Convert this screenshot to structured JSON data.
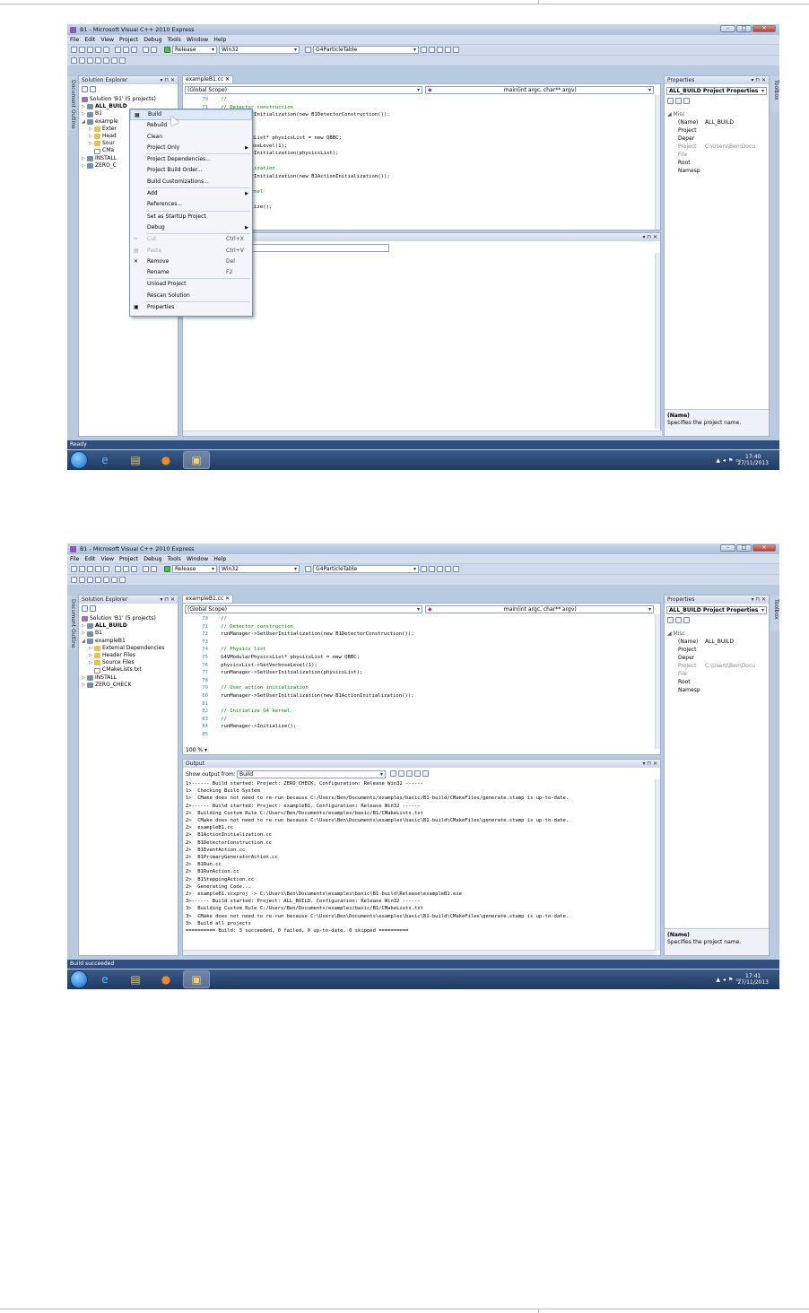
{
  "window": {
    "title": "B1 - Microsoft Visual C++ 2010 Express"
  },
  "menu": [
    "File",
    "Edit",
    "View",
    "Project",
    "Debug",
    "Tools",
    "Window",
    "Help"
  ],
  "toolbar": {
    "configuration": "Release",
    "platform": "Win32",
    "find_combo": "G4ParticleTable"
  },
  "solution_explorer": {
    "title": "Solution Explorer",
    "vertical_tab": "Document Outline",
    "items": [
      "Solution 'B1' (5 projects)",
      "ALL_BUILD",
      "B1",
      "exampleB1",
      "External Dependencies",
      "Header Files",
      "Source Files",
      "CMakeLists.txt",
      "INSTALL",
      "ZERO_CHECK"
    ],
    "truncated": {
      "exampleB1": "example",
      "external": "Exter",
      "header": "Head",
      "source": "Sour",
      "cmake": "CMa",
      "install": "INSTALL",
      "zero": "ZERO_C"
    }
  },
  "editor": {
    "tab": "exampleB1.cc",
    "scope": "(Global Scope)",
    "function": "main(int argc, char** argv)",
    "zoom": "100 %",
    "lines": [
      {
        "n": "70",
        "t": "   //",
        "c": "cm"
      },
      {
        "n": "71",
        "t": "   // Detector construction",
        "c": "cm"
      },
      {
        "n": "72",
        "t": "   runManager->SetUserInitialization(new B1DetectorConstruction());",
        "c": ""
      },
      {
        "n": "73",
        "t": "",
        "c": ""
      },
      {
        "n": "74",
        "t": "   // Physics list",
        "c": "cm"
      },
      {
        "n": "75",
        "t": "   G4VModularPhysicsList* physicsList = new QBBC;",
        "c": ""
      },
      {
        "n": "76",
        "t": "   physicsList->SetVerboseLevel(1);",
        "c": ""
      },
      {
        "n": "77",
        "t": "   runManager->SetUserInitialization(physicsList);",
        "c": ""
      },
      {
        "n": "78",
        "t": "",
        "c": ""
      },
      {
        "n": "79",
        "t": "   // User action initialization",
        "c": "cm"
      },
      {
        "n": "80",
        "t": "   runManager->SetUserInitialization(new B1ActionInitialization());",
        "c": ""
      },
      {
        "n": "81",
        "t": "",
        "c": ""
      },
      {
        "n": "82",
        "t": "   // Initialize G4 kernel",
        "c": "cm"
      },
      {
        "n": "83",
        "t": "   //",
        "c": "cm"
      },
      {
        "n": "84",
        "t": "   runManager->Initialize();",
        "c": ""
      },
      {
        "n": "85",
        "t": "",
        "c": ""
      }
    ],
    "partial_lines_1": [
      {
        "t": "   //",
        "c": "cm"
      },
      {
        "t": "   // Detector construction",
        "c": "cm"
      },
      {
        "t": "nager->SetUserInitialization(new B1DetectorConstruction());",
        "c": ""
      },
      {
        "t": "",
        "c": ""
      },
      {
        "t": "ics list",
        "c": "cm"
      },
      {
        "t": "ModularPhysicsList* physicsList = new QBBC;",
        "c": ""
      },
      {
        "t": "list->SetVerboseLevel(1);",
        "c": ""
      },
      {
        "t": "nager->SetUserInitialization(physicsList);",
        "c": ""
      },
      {
        "t": "",
        "c": ""
      },
      {
        "t": "action initialization",
        "c": "cm"
      },
      {
        "t": "nager->SetUserInitialization(new B1ActionInitialization());",
        "c": ""
      },
      {
        "t": "",
        "c": ""
      },
      {
        "t": "tialize G4 kernel",
        "c": "cm"
      },
      {
        "t": "",
        "c": ""
      },
      {
        "t": "nager->Initialize();",
        "c": ""
      }
    ]
  },
  "output": {
    "title": "Output",
    "show_from_label": "Show output from:",
    "show_from_value": "Build",
    "lines": [
      "1>------ Build started: Project: ZERO_CHECK, Configuration: Release Win32 ------",
      "1>  Checking Build System",
      "1>  CMake does not need to re-run because C:/Users/Ben/Documents/examples/basic/B1-build/CMakeFiles/generate.stamp is up-to-date.",
      "2>------ Build started: Project: exampleB1, Configuration: Release Win32 ------",
      "2>  Building Custom Rule C:/Users/Ben/Documents/examples/basic/B1/CMakeLists.txt",
      "2>  CMake does not need to re-run because C:\\Users\\Ben\\Documents\\examples\\basic\\B1-build\\CMakeFiles\\generate.stamp is up-to-date.",
      "2>  exampleB1.cc",
      "2>  B1ActionInitialization.cc",
      "2>  B1DetectorConstruction.cc",
      "2>  B1EventAction.cc",
      "2>  B1PrimaryGeneratorAction.cc",
      "2>  B1Run.cc",
      "2>  B1RunAction.cc",
      "2>  B1SteppingAction.cc",
      "2>  Generating Code...",
      "2>  exampleB1.vcxproj -> C:\\Users\\Ben\\Documents\\examples\\basic\\B1-build\\Release\\exampleB1.exe",
      "3>------ Build started: Project: ALL_BUILD, Configuration: Release Win32 ------",
      "3>  Building Custom Rule C:/Users/Ben/Documents/examples/basic/B1/CMakeLists.txt",
      "3>  CMake does not need to re-run because C:\\Users\\Ben\\Documents\\examples\\basic\\B1-build\\CMakeFiles\\generate.stamp is up-to-date.",
      "3>  Build all projects",
      "========== Build: 3 succeeded, 0 failed, 0 up-to-date, 0 skipped =========="
    ]
  },
  "properties": {
    "title": "Properties",
    "vertical_tab": "Toolbox",
    "object": "ALL_BUILD  Project Properties",
    "category": "Misc",
    "rows": [
      {
        "k": "(Name)",
        "v": "ALL_BUILD",
        "dim": false
      },
      {
        "k": "Project Deper",
        "v": "",
        "dim": false
      },
      {
        "k": "Project File",
        "v": "C:\\Users\\Ben\\Docu",
        "dim": true
      },
      {
        "k": "Root Namesp",
        "v": "",
        "dim": false
      }
    ],
    "desc_title": "(Name)",
    "desc_text": "Specifies the project name."
  },
  "context_menu": {
    "items": [
      {
        "label": "Build",
        "shortcut": "",
        "arrow": false,
        "hl": true,
        "dis": false,
        "icon": "build-icon",
        "sep_after": false
      },
      {
        "label": "Rebuild",
        "shortcut": "",
        "arrow": false,
        "hl": false,
        "dis": false,
        "icon": "",
        "sep_after": false
      },
      {
        "label": "Clean",
        "shortcut": "",
        "arrow": false,
        "hl": false,
        "dis": false,
        "icon": "",
        "sep_after": false
      },
      {
        "label": "Project Only",
        "shortcut": "",
        "arrow": true,
        "hl": false,
        "dis": false,
        "icon": "",
        "sep_after": true
      },
      {
        "label": "Project Dependencies...",
        "shortcut": "",
        "arrow": false,
        "hl": false,
        "dis": false,
        "icon": "",
        "sep_after": false
      },
      {
        "label": "Project Build Order...",
        "shortcut": "",
        "arrow": false,
        "hl": false,
        "dis": false,
        "icon": "",
        "sep_after": false
      },
      {
        "label": "Build Customizations...",
        "shortcut": "",
        "arrow": false,
        "hl": false,
        "dis": false,
        "icon": "",
        "sep_after": true
      },
      {
        "label": "Add",
        "shortcut": "",
        "arrow": true,
        "hl": false,
        "dis": false,
        "icon": "",
        "sep_after": false
      },
      {
        "label": "References...",
        "shortcut": "",
        "arrow": false,
        "hl": false,
        "dis": false,
        "icon": "",
        "sep_after": true
      },
      {
        "label": "Set as StartUp Project",
        "shortcut": "",
        "arrow": false,
        "hl": false,
        "dis": false,
        "icon": "",
        "sep_after": false
      },
      {
        "label": "Debug",
        "shortcut": "",
        "arrow": true,
        "hl": false,
        "dis": false,
        "icon": "",
        "sep_after": true
      },
      {
        "label": "Cut",
        "shortcut": "Ctrl+X",
        "arrow": false,
        "hl": false,
        "dis": true,
        "icon": "cut-icon",
        "sep_after": false
      },
      {
        "label": "Paste",
        "shortcut": "Ctrl+V",
        "arrow": false,
        "hl": false,
        "dis": true,
        "icon": "paste-icon",
        "sep_after": false
      },
      {
        "label": "Remove",
        "shortcut": "Del",
        "arrow": false,
        "hl": false,
        "dis": false,
        "icon": "remove-icon",
        "sep_after": false
      },
      {
        "label": "Rename",
        "shortcut": "F2",
        "arrow": false,
        "hl": false,
        "dis": false,
        "icon": "",
        "sep_after": true
      },
      {
        "label": "Unload Project",
        "shortcut": "",
        "arrow": false,
        "hl": false,
        "dis": false,
        "icon": "",
        "sep_after": false
      },
      {
        "label": "Rescan Solution",
        "shortcut": "",
        "arrow": false,
        "hl": false,
        "dis": false,
        "icon": "",
        "sep_after": true
      },
      {
        "label": "Properties",
        "shortcut": "",
        "arrow": false,
        "hl": false,
        "dis": false,
        "icon": "properties-icon",
        "sep_after": false
      }
    ]
  },
  "status": {
    "s1": "Ready",
    "s2": "Build succeeded"
  },
  "clock": {
    "s1_time": "17:40",
    "s1_date": "27/11/2013",
    "s2_time": "17:41",
    "s2_date": "27/11/2013"
  },
  "colors": {
    "status_bar": "#2f4f80",
    "highlight": "#dde9f8",
    "comment": "#008000",
    "line_number": "#2b91af"
  }
}
